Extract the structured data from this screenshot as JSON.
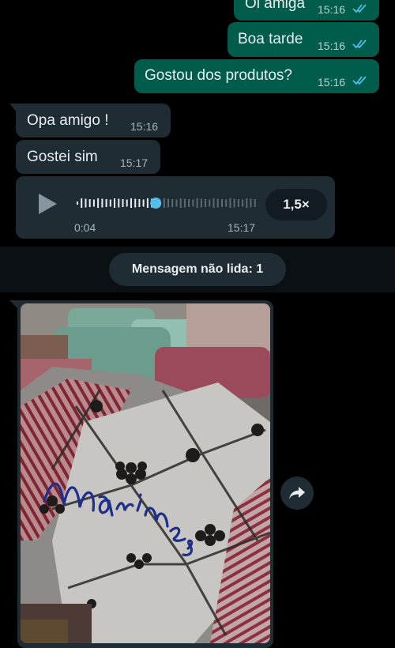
{
  "messages": [
    {
      "text": "Oi amiga",
      "time": "15:16",
      "direction": "outgoing",
      "status": "read"
    },
    {
      "text": "Boa tarde",
      "time": "15:16",
      "direction": "outgoing",
      "status": "read"
    },
    {
      "text": "Gostou dos produtos?",
      "time": "15:16",
      "direction": "outgoing",
      "status": "read"
    },
    {
      "text": "Opa amigo !",
      "time": "15:16",
      "direction": "incoming"
    },
    {
      "text": "Gostei sim",
      "time": "15:17",
      "direction": "incoming"
    }
  ],
  "voice_message": {
    "position": "0:04",
    "time": "15:17",
    "speed": "1,5×",
    "progress": 0.44
  },
  "unread_banner": {
    "label": "Mensagem não lida: 1"
  },
  "image_message": {
    "handwritten_text": "Marines"
  },
  "colors": {
    "background": "#000000",
    "outgoing_bubble": "#005c4b",
    "incoming_bubble": "#1f2c34",
    "read_ticks": "#53bdeb",
    "progress_dot": "#53bdeb"
  },
  "icons": {
    "play": "play-icon",
    "read": "double-check-icon",
    "forward": "forward-icon"
  }
}
